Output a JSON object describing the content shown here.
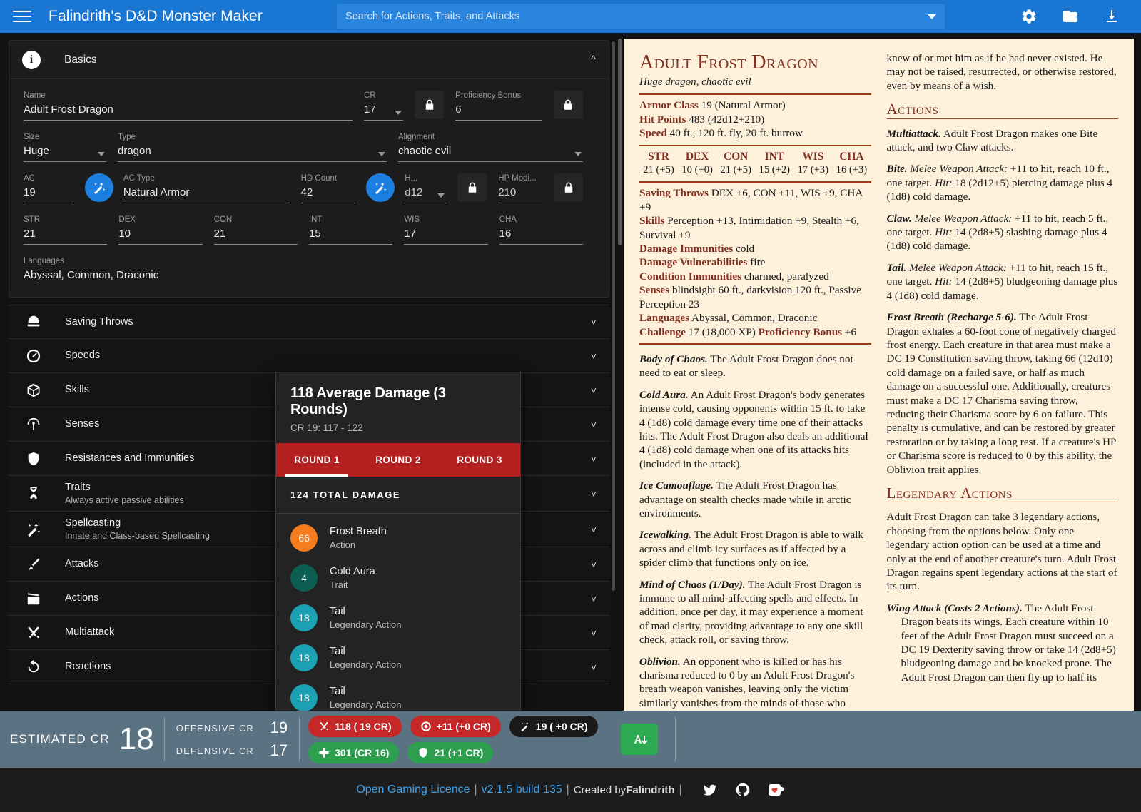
{
  "topbar": {
    "title": "Falindrith's D&D Monster Maker",
    "search_placeholder": "Search for Actions, Traits, and Attacks",
    "search_value": "",
    "icons": [
      "gear-icon",
      "folder-open-icon",
      "download-icon"
    ],
    "accent": "#1976d2"
  },
  "basics": {
    "header": "Basics",
    "fields": {
      "name_label": "Name",
      "name_value": "Adult Frost Dragon",
      "cr_label": "CR",
      "cr_value": "17",
      "prof_label": "Proficiency Bonus",
      "prof_value": "6",
      "size_label": "Size",
      "size_value": "Huge",
      "type_label": "Type",
      "type_value": "dragon",
      "alignment_label": "Alignment",
      "alignment_value": "chaotic evil",
      "ac_label": "AC",
      "ac_value": "19",
      "ac_type_label": "AC Type",
      "ac_type_value": "Natural Armor",
      "hd_count_label": "HD Count",
      "hd_count_value": "42",
      "hd_type_label": "H...",
      "hd_type_value": "d12",
      "hp_mod_label": "HP Modi...",
      "hp_mod_value": "210",
      "languages_label": "Languages",
      "languages_value": "Abyssal, Common, Draconic"
    },
    "abilities": [
      {
        "label": "STR",
        "value": "21"
      },
      {
        "label": "DEX",
        "value": "10"
      },
      {
        "label": "CON",
        "value": "21"
      },
      {
        "label": "INT",
        "value": "15"
      },
      {
        "label": "WIS",
        "value": "17"
      },
      {
        "label": "CHA",
        "value": "16"
      }
    ]
  },
  "accordion": [
    {
      "icon": "helmet-icon",
      "label": "Saving Throws",
      "sub": ""
    },
    {
      "icon": "speedometer-icon",
      "label": "Speeds",
      "sub": ""
    },
    {
      "icon": "d20-dice-icon",
      "label": "Skills",
      "sub": ""
    },
    {
      "icon": "sense-antenna-icon",
      "label": "Senses",
      "sub": ""
    },
    {
      "icon": "shield-icon",
      "label": "Resistances and Immunities",
      "sub": ""
    },
    {
      "icon": "dna-icon",
      "label": "Traits",
      "sub": "Always active passive abilities"
    },
    {
      "icon": "magic-wand-icon",
      "label": "Spellcasting",
      "sub": "Innate and Class-based Spellcasting"
    },
    {
      "icon": "sword-icon",
      "label": "Attacks",
      "sub": ""
    },
    {
      "icon": "clapperboard-icon",
      "label": "Actions",
      "sub": ""
    },
    {
      "icon": "crossed-swords-icon",
      "label": "Multiattack",
      "sub": ""
    },
    {
      "icon": "reaction-arrow-icon",
      "label": "Reactions",
      "sub": ""
    }
  ],
  "damage_popup": {
    "title": "118 Average Damage (3 Rounds)",
    "subtitle": "CR 19: 117 - 122",
    "tabs": [
      "ROUND 1",
      "ROUND 2",
      "ROUND 3"
    ],
    "active_tab": 0,
    "total_label": "124 TOTAL DAMAGE",
    "items": [
      {
        "value": "66",
        "name": "Frost Breath",
        "type": "Action",
        "color": "#f57c1f"
      },
      {
        "value": "4",
        "name": "Cold Aura",
        "type": "Trait",
        "color": "#0d5e52"
      },
      {
        "value": "18",
        "name": "Tail",
        "type": "Legendary Action",
        "color": "#1ba0b4"
      },
      {
        "value": "18",
        "name": "Tail",
        "type": "Legendary Action",
        "color": "#1ba0b4"
      },
      {
        "value": "18",
        "name": "Tail",
        "type": "Legendary Action",
        "color": "#1ba0b4"
      }
    ],
    "tab_color": "#b3201f"
  },
  "statblock": {
    "name": "Adult Frost Dragon",
    "subtitle": "Huge dragon, chaotic evil",
    "armor_class_label": "Armor Class",
    "armor_class_value": "19 (Natural Armor)",
    "hit_points_label": "Hit Points",
    "hit_points_value": "483 (42d12+210)",
    "speed_label": "Speed",
    "speed_value": "40 ft., 120 ft. fly, 20 ft. burrow",
    "abilities": [
      {
        "name": "STR",
        "score": "21 (+5)"
      },
      {
        "name": "DEX",
        "score": "10 (+0)"
      },
      {
        "name": "CON",
        "score": "21 (+5)"
      },
      {
        "name": "INT",
        "score": "15 (+2)"
      },
      {
        "name": "WIS",
        "score": "17 (+3)"
      },
      {
        "name": "CHA",
        "score": "16 (+3)"
      }
    ],
    "saving_throws_label": "Saving Throws",
    "saving_throws_value": "DEX +6, CON +11, WIS +9, CHA +9",
    "skills_label": "Skills",
    "skills_value": "Perception +13, Intimidation +9, Stealth +6, Survival +9",
    "damage_immunities_label": "Damage Immunities",
    "damage_immunities_value": "cold",
    "damage_vulnerabilities_label": "Damage Vulnerabilities",
    "damage_vulnerabilities_value": "fire",
    "condition_immunities_label": "Condition Immunities",
    "condition_immunities_value": "charmed, paralyzed",
    "senses_label": "Senses",
    "senses_value": "blindsight 60 ft., darkvision 120 ft., Passive Perception 23",
    "languages_label": "Languages",
    "languages_value": "Abyssal, Common, Draconic",
    "challenge_label": "Challenge",
    "challenge_value": "17 (18,000 XP)",
    "prof_bonus_label": "Proficiency Bonus",
    "prof_bonus_value": "+6",
    "traits": [
      {
        "name": "Body of Chaos.",
        "text": " The Adult Frost Dragon does not need to eat or sleep."
      },
      {
        "name": "Cold Aura.",
        "text": " An Adult Frost Dragon's body generates intense cold, causing opponents within 15 ft. to take 4 (1d8) cold damage every time one of their attacks hits. The Adult Frost Dragon also deals an additional 4 (1d8) cold damage when one of its attacks hits (included in the attack)."
      },
      {
        "name": "Ice Camouflage.",
        "text": " The Adult Frost Dragon has advantage on stealth checks made while in arctic environments."
      },
      {
        "name": "Icewalking.",
        "text": " The Adult Frost Dragon is able to walk across and climb icy surfaces as if affected by a spider climb that functions only on ice."
      },
      {
        "name": "Mind of Chaos (1/Day).",
        "text": " The Adult Frost Dragon is immune to all mind-affecting spells and effects. In addition, once per day, it may experience a moment of mad clarity, providing advantage to any one skill check, attack roll, or saving throw."
      },
      {
        "name": "Oblivion.",
        "text": " An opponent who is killed or has his charisma reduced to 0 by an Adult Frost Dragon's breath weapon vanishes, leaving only the victim similarly vanishes from the minds of those who knew of or met him as if he had never existed. He may not be raised, resurrected, or otherwise restored, even by means of a wish."
      }
    ],
    "actions_heading": "Actions",
    "actions": [
      {
        "name": "Multiattack.",
        "text": " Adult Frost Dragon makes one Bite attack, and two Claw attacks."
      },
      {
        "name": "Bite.",
        "attack": "Melee Weapon Attack:",
        "text": " +11 to hit, reach 10 ft., one target. ",
        "hit": "Hit:",
        "hit_text": " 18 (2d12+5) piercing damage plus 4 (1d8) cold damage."
      },
      {
        "name": "Claw.",
        "attack": "Melee Weapon Attack:",
        "text": " +11 to hit, reach 5 ft., one target. ",
        "hit": "Hit:",
        "hit_text": " 14 (2d8+5) slashing damage plus 4 (1d8) cold damage."
      },
      {
        "name": "Tail.",
        "attack": "Melee Weapon Attack:",
        "text": " +11 to hit, reach 15 ft., one target. ",
        "hit": "Hit:",
        "hit_text": " 14 (2d8+5) bludgeoning damage plus 4 (1d8) cold damage."
      },
      {
        "name": "Frost Breath (Recharge 5-6).",
        "text": " The Adult Frost Dragon exhales a 60-foot cone of negatively charged frost energy. Each creature in that area must make a DC 19 Constitution saving throw, taking 66 (12d10) cold damage on a failed save, or half as much damage on a successful one. Additionally, creatures must make a DC 17 Charisma saving throw, reducing their Charisma score by 6 on failure. This penalty is cumulative, and can be restored by greater restoration or by taking a long rest. If a creature's HP or Charisma score is reduced to 0 by this ability, the Oblivion trait applies."
      }
    ],
    "legendary_heading": "Legendary Actions",
    "legendary_intro": "Adult Frost Dragon can take 3 legendary actions, choosing from the options below. Only one legendary action option can be used at a time and only at the end of another creature's turn. Adult Frost Dragon regains spent legendary actions at the start of its turn.",
    "legendary_actions": [
      {
        "name": "Wing Attack (Costs 2 Actions).",
        "text": " The Adult Frost Dragon beats its wings. Each creature within 10 feet of the Adult Frost Dragon must succeed on a DC 19 Dexterity saving throw or take 14 (2d8+5) bludgeoning damage and be knocked prone. The Adult Frost Dragon can then fly up to half its"
      }
    ]
  },
  "cr_bar": {
    "estimated_label": "Estimated CR",
    "estimated_value": "18",
    "offensive_label": "Offensive CR",
    "offensive_value": "19",
    "defensive_label": "Defensive CR",
    "defensive_value": "17",
    "pills": [
      {
        "icon": "crossed-swords-icon",
        "text": "118 ( 19 CR)",
        "style": "red"
      },
      {
        "icon": "target-icon",
        "text": "+11 (+0 CR)",
        "style": "red"
      },
      {
        "icon": "magic-wand-icon",
        "text": "19 ( +0 CR)",
        "style": "dark"
      },
      {
        "icon": "cross-heal-icon",
        "text": "301 (CR 16)",
        "style": "green"
      },
      {
        "icon": "shield-icon",
        "text": "21 (+1 CR)",
        "style": "green"
      }
    ],
    "auto_button": "auto-adjust-icon",
    "bg": "#5b7282"
  },
  "footer": {
    "licence": "Open Gaming Licence",
    "version": "v2.1.5 build 135",
    "created_by_prefix": "Created by ",
    "author": "Falindrith",
    "icons": [
      "twitter-icon",
      "github-icon",
      "kofi-icon"
    ]
  }
}
